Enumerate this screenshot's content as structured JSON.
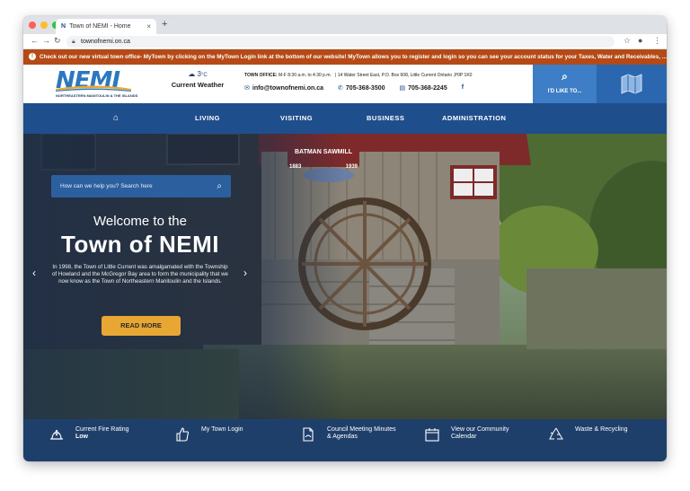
{
  "browser": {
    "tab_title": "Town of NEMI - Home",
    "tab_favicon": "N",
    "tab_close": "×",
    "new_tab": "+",
    "url": "townofnemi.on.ca"
  },
  "alert": {
    "text": "Check out our new virtual town office- MyTown by clicking on the MyTown Login link at the bottom of our website! MyTown allows you to register and login so you can see your account status for your Taxes, Water and Receivables, ..."
  },
  "header": {
    "logo_text": "NEMI",
    "logo_subtext": "NORTHEASTERN MANITOULIN & THE ISLANDS",
    "weather_temp": "3",
    "weather_unit": "°C",
    "weather_label": "Current Weather",
    "office_label": "TOWN OFFICE:",
    "office_hours": "M-F 8:30 a.m. to 4:30 p.m.",
    "office_address": "| 14 Water Street East, P.O. Box 608, Little Current Ontario ,P0P 1K0",
    "email": "info@townofnemi.on.ca",
    "phone": "705-368-3500",
    "fax": "705-368-2245",
    "facebook_icon": "f",
    "like_label": "I'D LIKE TO..."
  },
  "nav": {
    "home_icon": "⌂",
    "items": [
      "LIVING",
      "VISITING",
      "BUSINESS",
      "ADMINISTRATION"
    ]
  },
  "hero": {
    "search_placeholder": "How can we help you? Search here",
    "welcome_line1": "Welcome to the",
    "welcome_line2": "Town of NEMI",
    "intro": "In 1998, the Town of Little Current was amalgamated with the Township of Howland and the McGregor Bay area to form the municipality that we now know as the Town of Northeastern Manitoulin and the Islands.",
    "read_more": "READ MORE",
    "sign_line1": "BATMAN SAWMILL",
    "sign_year1": "1883",
    "sign_year2": "1939",
    "prev_arrow": "‹",
    "next_arrow": "›"
  },
  "quick_links": [
    {
      "label": "Current Fire Rating",
      "sub": "Low",
      "icon": "fire-rating-icon"
    },
    {
      "label": "My Town Login",
      "sub": "",
      "icon": "thumbs-up-icon"
    },
    {
      "label": "Council Meeting Minutes & Agendas",
      "sub": "",
      "icon": "document-icon"
    },
    {
      "label": "View our Community Calendar",
      "sub": "",
      "icon": "calendar-icon"
    },
    {
      "label": "Waste & Recycling",
      "sub": "",
      "icon": "recycle-icon"
    }
  ],
  "colors": {
    "nav_blue": "#1f4e8c",
    "alert_orange": "#b54a16",
    "button_gold": "#e8a733",
    "like_blue": "#3d7ec6"
  }
}
